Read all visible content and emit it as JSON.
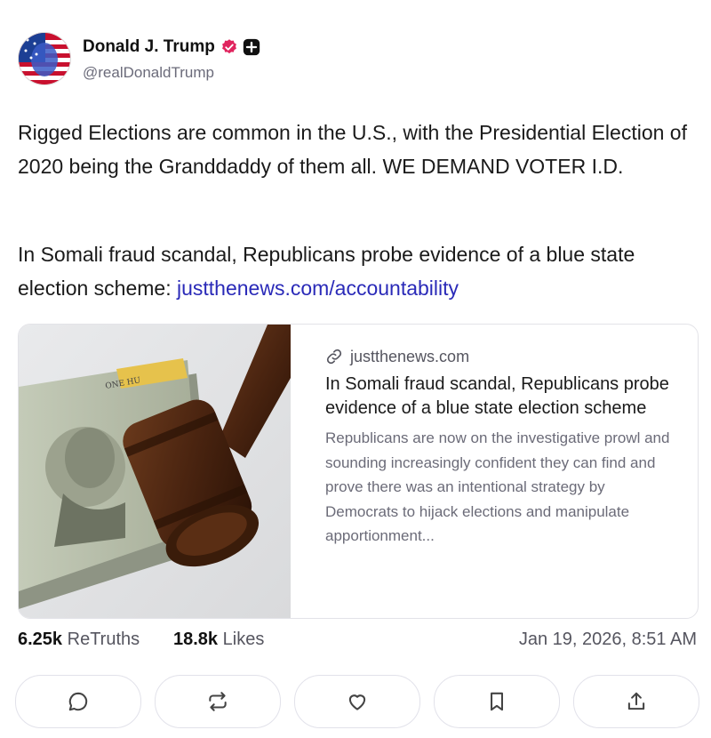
{
  "author": {
    "name": "Donald J. Trump",
    "handle": "@realDonaldTrump",
    "verified_icon": "verified-badge-icon",
    "plus_icon": "plus-badge-icon",
    "accent_color": "#e0245e"
  },
  "post": {
    "paragraph1": "Rigged Elections are common in the U.S., with the Presidential Election of 2020 being the Granddaddy of them all. WE DEMAND VOTER I.D.",
    "paragraph2_text": "In Somali fraud scandal, Republicans probe evidence of a blue state election scheme: ",
    "paragraph2_link": "justthenews.com/accountability",
    "link_color": "#2a2ab8"
  },
  "card": {
    "domain": "justthenews.com",
    "title": "In Somali fraud scandal, Republicans probe evidence of a blue state election scheme",
    "description": "Republicans are now on the investigative prowl and sounding increasingly confident they can find and prove there was an intentional strategy by Democrats to hijack elections and manipulate apportionment...",
    "image_alt": "gavel-on-hundred-dollar-bills-image"
  },
  "stats": {
    "retruths_count": "6.25k",
    "retruths_label": "ReTruths",
    "likes_count": "18.8k",
    "likes_label": "Likes",
    "timestamp": "Jan 19, 2026, 8:51 AM"
  },
  "actions": [
    {
      "name": "reply",
      "icon": "comment-icon"
    },
    {
      "name": "retruth",
      "icon": "repost-icon"
    },
    {
      "name": "like",
      "icon": "heart-icon"
    },
    {
      "name": "bookmark",
      "icon": "bookmark-icon"
    },
    {
      "name": "share",
      "icon": "share-icon"
    }
  ]
}
